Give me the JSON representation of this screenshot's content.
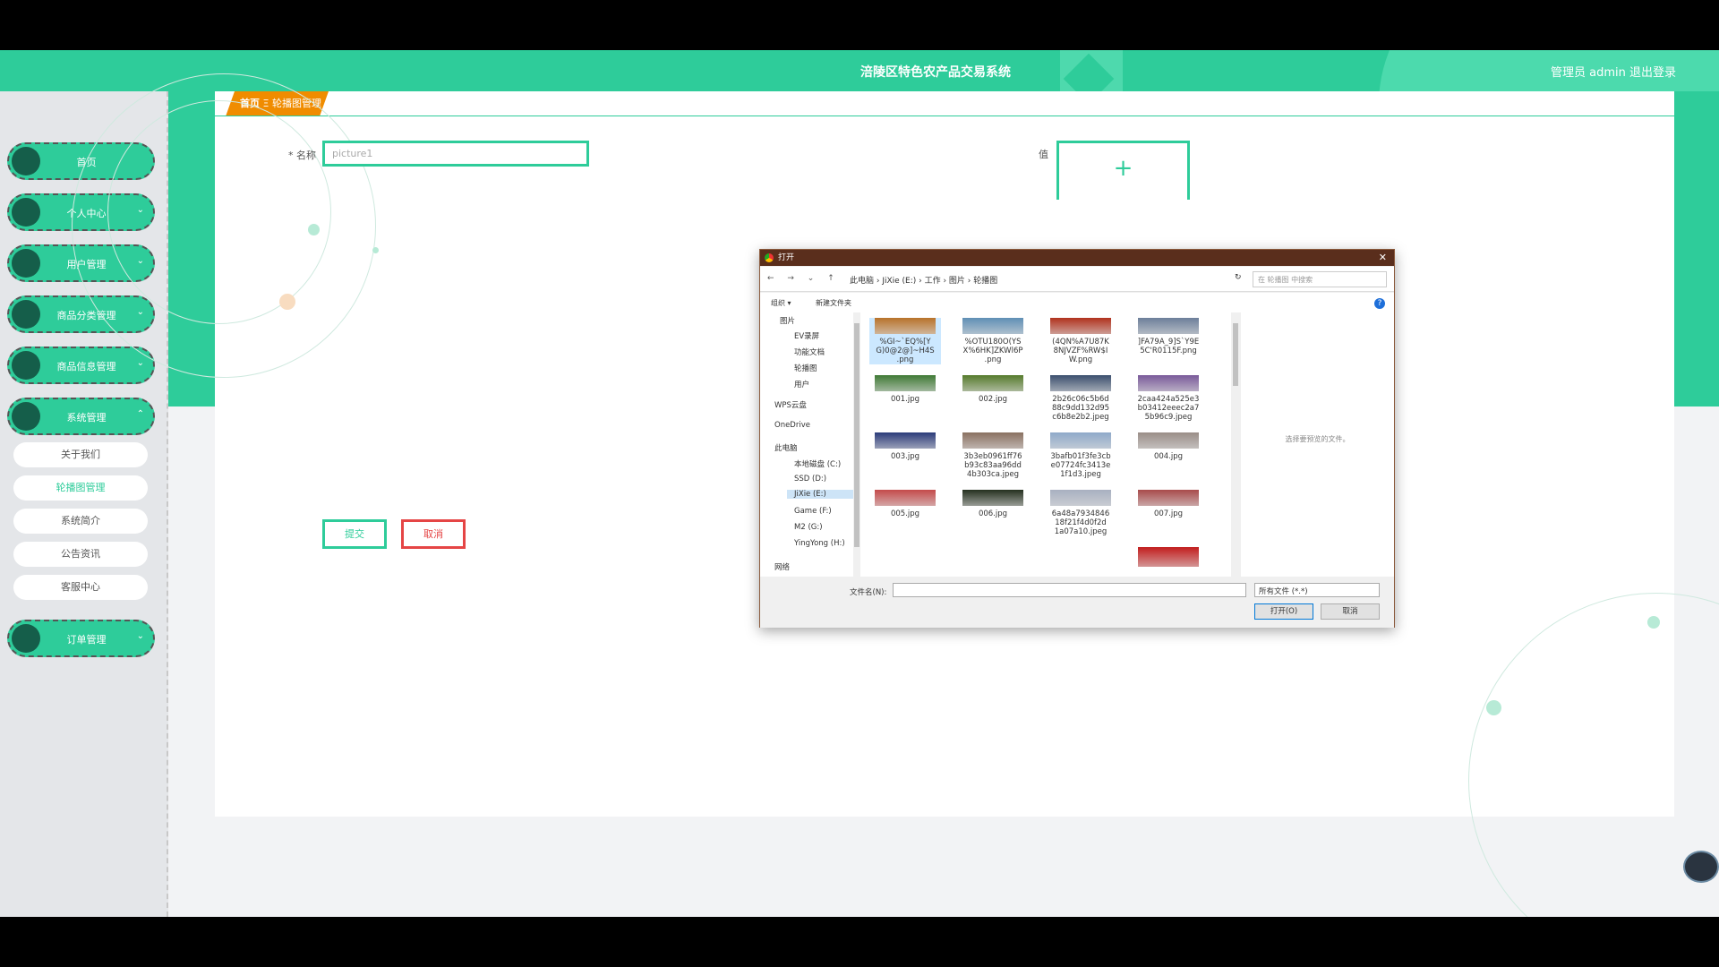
{
  "app": {
    "title": "涪陵区特色农产品交易系统",
    "user_info": "管理员 admin  退出登录"
  },
  "sidebar": {
    "items": [
      {
        "label": "首页",
        "chevron": ""
      },
      {
        "label": "个人中心",
        "chevron": "⌄"
      },
      {
        "label": "用户管理",
        "chevron": "⌄"
      },
      {
        "label": "商品分类管理",
        "chevron": "⌄"
      },
      {
        "label": "商品信息管理",
        "chevron": "⌄"
      },
      {
        "label": "系统管理",
        "chevron": "⌃"
      },
      {
        "label": "订单管理",
        "chevron": "⌄"
      }
    ],
    "sub_items": [
      {
        "label": "关于我们"
      },
      {
        "label": "轮播图管理"
      },
      {
        "label": "系统简介"
      },
      {
        "label": "公告资讯"
      },
      {
        "label": "客服中心"
      }
    ]
  },
  "breadcrumb": {
    "home": "首页",
    "separator": "Ξ",
    "current": "轮播图管理"
  },
  "form": {
    "name_label": "* 名称",
    "name_value": "picture1",
    "value_label": "值",
    "upload_plus": "+",
    "submit_label": "提交",
    "cancel_label": "取消"
  },
  "dialog": {
    "title": "打开",
    "close": "✕",
    "nav": "← → ⌄ ↑",
    "path": "此电脑 › JiXie (E:) › 工作 › 图片 › 轮播图",
    "refresh": "↻",
    "search_placeholder": "在 轮播图 中搜索",
    "organize": "组织 ▾",
    "new_folder": "新建文件夹",
    "help": "?",
    "tree": [
      "图片",
      "EV录屏",
      "功能文档",
      "轮播图",
      "用户",
      "WPS云盘",
      "OneDrive",
      "此电脑",
      "本地磁盘 (C:)",
      "SSD (D:)",
      "JiXie (E:)",
      "Game (F:)",
      "M2 (G:)",
      "YingYong (H:)",
      "网络"
    ],
    "files": [
      {
        "name": "%GI~`EQ%[Y G)0@2@]~H4S .png",
        "color": "#b8722a"
      },
      {
        "name": "%OTU180O(YS X%6HK]ZKWl6P .png",
        "color": "#5f8fb5"
      },
      {
        "name": "(4QN%A7U87K 8NJVZF%RW$I W.png",
        "color": "#b1321d"
      },
      {
        "name": "]FA79A_9]S`Y9E 5C'R0115F.png",
        "color": "#6c7f9a"
      },
      {
        "name": "001.jpg",
        "color": "#3f7a35"
      },
      {
        "name": "002.jpg",
        "color": "#567b2c"
      },
      {
        "name": "2b26c06c5b6d 88c9dd132d95 c6b8e2b2.jpeg",
        "color": "#3b4f6e"
      },
      {
        "name": "2caa424a525e3 b03412eeec2a7 5b96c9.jpeg",
        "color": "#7a5a9a"
      },
      {
        "name": "003.jpg",
        "color": "#2b3b7a"
      },
      {
        "name": "3b3eb0961ff76 b93c83aa96dd 4b303ca.jpeg",
        "color": "#8a7060"
      },
      {
        "name": "3bafb01f3fe3cb e07724fc3413e 1f1d3.jpeg",
        "color": "#8fa9c9"
      },
      {
        "name": "004.jpg",
        "color": "#9a8e88"
      },
      {
        "name": "005.jpg",
        "color": "#c44a4a"
      },
      {
        "name": "006.jpg",
        "color": "#25301f"
      },
      {
        "name": "6a48a7934846 18f21f4d0f2d 1a07a10.jpeg",
        "color": "#a8b0c0"
      },
      {
        "name": "007.jpg",
        "color": "#a84a4a"
      },
      {
        "name": "",
        "color": "#c21d1d"
      }
    ],
    "preview_text": "选择要预览的文件。",
    "filename_label": "文件名(N):",
    "filetype_value": "所有文件 (*.*)",
    "open_label": "打开(O)",
    "cancel_label": "取消"
  }
}
